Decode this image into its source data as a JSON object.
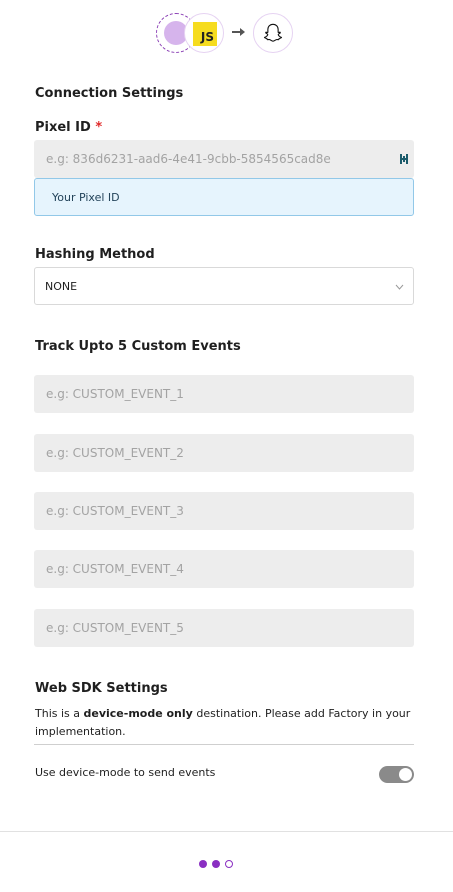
{
  "connection": {
    "section_title": "Connection Settings",
    "pixel_label": "Pixel ID",
    "required_mark": "*",
    "pixel_placeholder": "e.g: 836d6231-aad6-4e41-9cbb-5854565cad8e",
    "pixel_hint": "Your Pixel ID",
    "hashing_label": "Hashing Method",
    "hashing_value": "NONE"
  },
  "custom_events": {
    "title": "Track Upto 5 Custom Events",
    "placeholders": [
      "e.g: CUSTOM_EVENT_1",
      "e.g: CUSTOM_EVENT_2",
      "e.g: CUSTOM_EVENT_3",
      "e.g: CUSTOM_EVENT_4",
      "e.g: CUSTOM_EVENT_5"
    ]
  },
  "web_sdk": {
    "title": "Web SDK Settings",
    "desc_prefix": "This is a ",
    "desc_bold": "device-mode only",
    "desc_suffix": " destination. Please add Factory in your implementation.",
    "toggle_label": "Use device-mode to send events",
    "toggle_on": true
  },
  "header": {
    "source_icon": "source-dot-icon",
    "js_icon_text": "JS",
    "arrow_icon": "arrow-right-icon",
    "destination_icon": "snapchat-ghost-icon"
  },
  "pagination": {
    "total": 3,
    "completed": 2
  },
  "colors": {
    "accent": "#8a2fc2",
    "hint_bg": "#e6f4fd",
    "hint_border": "#92c8e8",
    "input_bg": "#ededed",
    "required": "#e02a2a",
    "js_yellow": "#f6dc1f"
  }
}
